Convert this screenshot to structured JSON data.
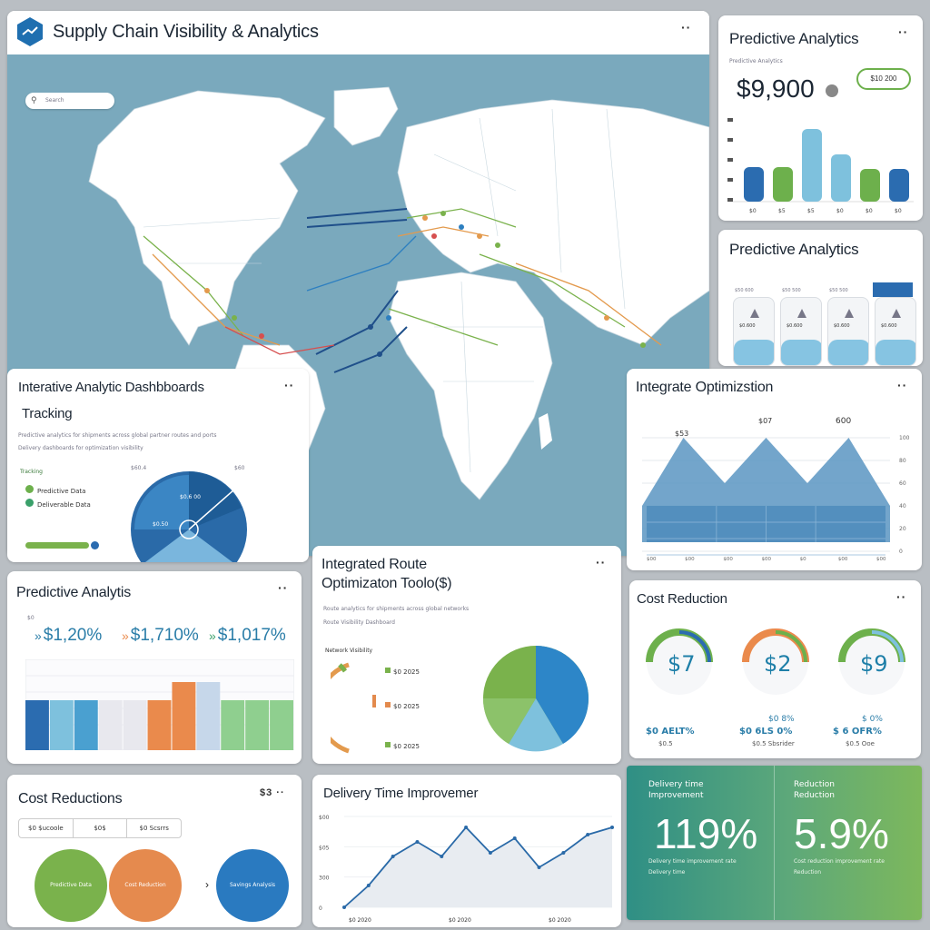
{
  "header": {
    "title": "Supply Chain Visibility & Analytics",
    "menu": "··",
    "search_placeholder": "Search"
  },
  "map": {
    "ocean_color": "#7aa9bd",
    "land_color": "#ffffff"
  },
  "pa_top": {
    "title": "Predictive Analytics",
    "menu": "··",
    "subtitle": "Predictive Analytics",
    "value": "$9,900",
    "pill": "$10 200",
    "bars": [
      {
        "label": "$0",
        "value": 38,
        "color": "#2b6cb0"
      },
      {
        "label": "$0",
        "value": 38,
        "color": "#6db04c"
      },
      {
        "label": "$0",
        "value": 80,
        "color": "#7ec1dd"
      },
      {
        "label": "$0",
        "value": 52,
        "color": "#7ec1dd"
      },
      {
        "label": "$0",
        "value": 36,
        "color": "#6db04c"
      },
      {
        "label": "$0",
        "value": 36,
        "color": "#2b6cb0"
      }
    ],
    "bar_labels": [
      "$0",
      "$5",
      "$5",
      "$0",
      "$0",
      "$0"
    ]
  },
  "pa_tiles": {
    "title": "Predictive Analytics",
    "tiles": [
      {
        "label": "$0.600"
      },
      {
        "label": "$0.600"
      },
      {
        "label": "$0.600"
      },
      {
        "label": "$0.600"
      }
    ],
    "header_labels": [
      "$50 600",
      "$50 500",
      "$50 500",
      "$50 500"
    ]
  },
  "iad": {
    "title": "Interative Analytic Dashbboards",
    "subtitle": "Tracking",
    "menu": "··",
    "desc1": "Predictive analytics for shipments across global partner routes and ports",
    "desc2": "Delivery dashboards for optimization visibility",
    "legend_head": "Tracking",
    "legend": [
      {
        "label": "Predictive Data",
        "color": "#6db04c"
      },
      {
        "label": "Deliverable Data",
        "color": "#3aa06a"
      }
    ],
    "gauge_left": "$60.4",
    "gauge_right": "$60",
    "pie_label1": "$0.6 00",
    "pie_label2": "$0.50"
  },
  "io": {
    "title": "Integrate Optimizstion",
    "menu": "··",
    "label_a": "$53",
    "label_b": "$07",
    "label_c": "600",
    "yticks": [
      "100",
      "80",
      "60",
      "40",
      "20",
      "0"
    ],
    "xticks": [
      "$00",
      "$00",
      "$00",
      "$00",
      "$0",
      "$00",
      "$00"
    ],
    "chart_data": {
      "type": "area",
      "x": [
        0,
        1,
        2,
        3,
        4,
        5,
        6
      ],
      "series": [
        {
          "name": "Route",
          "values": [
            40,
            100,
            60,
            100,
            60,
            100,
            40
          ]
        }
      ]
    }
  },
  "pa_pct": {
    "title": "Predictive Analytis",
    "menu": "··",
    "tag": "$0",
    "metrics": [
      {
        "value": "$1,20%",
        "color": "#2a7da8"
      },
      {
        "value": "$1,710%",
        "color": "#2a7da8"
      },
      {
        "value": "$1,017%",
        "color": "#2a7da8"
      }
    ],
    "bars": [
      {
        "value": 55,
        "color": "#2b6cb0"
      },
      {
        "value": 55,
        "color": "#7ec1dd"
      },
      {
        "value": 55,
        "color": "#4aa0d0"
      },
      {
        "value": 55,
        "color": "#e8e8ee"
      },
      {
        "value": 55,
        "color": "#e8e8ee"
      },
      {
        "value": 55,
        "color": "#ea8a4c"
      },
      {
        "value": 75,
        "color": "#ea8a4c"
      },
      {
        "value": 75,
        "color": "#c6d7ea"
      },
      {
        "value": 55,
        "color": "#8fcf8f"
      },
      {
        "value": 55,
        "color": "#8fcf8f"
      },
      {
        "value": 55,
        "color": "#8fcf8f"
      }
    ]
  },
  "iro": {
    "title1": "Integrated Route",
    "title2": "Optimizaton Toolo($)",
    "menu": "··",
    "desc1": "Route analytics for shipments across global networks",
    "desc2": "Route Visibility Dashboard",
    "mini_label": "Network Visibility",
    "items": [
      "$0 2025",
      "$0 2025",
      "$0 2025"
    ]
  },
  "cost_top": {
    "title": "Cost Reduction",
    "menu": "··",
    "gauges": [
      {
        "value": "$7",
        "color": "#6db04c",
        "accent": "#2b6cb0"
      },
      {
        "value": "$2",
        "color": "#ea8a4c",
        "accent": "#6db04c"
      },
      {
        "value": "$9",
        "color": "#6db04c",
        "accent": "#7ec1dd"
      }
    ],
    "captions": [
      {
        "top": "",
        "main": "$0 AELT%",
        "sub": "$0.5"
      },
      {
        "top": "$0 8%",
        "main": "$0 6LS 0%",
        "sub": "$0.5 Sbsrider"
      },
      {
        "top": "$ 0%",
        "main": "$ 6 OFR%",
        "sub": "$0.5 Ooe"
      }
    ]
  },
  "cost_bottom": {
    "title": "Cost Reductions",
    "menu": "$3 ··",
    "tabs": [
      "$0 $ucoole",
      "$0$",
      "$0 Scsrrs"
    ],
    "circles": [
      {
        "label": "Predictive Data",
        "color": "#7ab24c"
      },
      {
        "label": "Cost Reduction",
        "color": "#e58a4e"
      },
      {
        "label": "Savings Analysis",
        "color": "#2a7ac0"
      }
    ]
  },
  "delivery": {
    "title": "Delivery Time Improvemer",
    "yticks": [
      "$00",
      "$05",
      "300",
      "0"
    ],
    "xticks": [
      "$0 2020",
      "$0 2020",
      "$0 2020"
    ],
    "chart_data": {
      "type": "line",
      "x": [
        0,
        1,
        2,
        3,
        4,
        5,
        6,
        7,
        8,
        9,
        10,
        11
      ],
      "series": [
        {
          "name": "Delivery",
          "values": [
            0,
            12,
            28,
            36,
            28,
            44,
            30,
            38,
            22,
            30,
            40,
            44
          ]
        }
      ]
    }
  },
  "green": {
    "left_head": "Delivery time",
    "left_sub": "Improvement",
    "left_value": "119%",
    "left_foot": "Delivery time improvement rate",
    "left_foot2": "Delivery time",
    "right_head": "Reduction",
    "right_sub": "Reduction",
    "right_value": "5.9%",
    "right_foot": "Cost reduction improvement rate",
    "right_foot2": "Reduction"
  }
}
